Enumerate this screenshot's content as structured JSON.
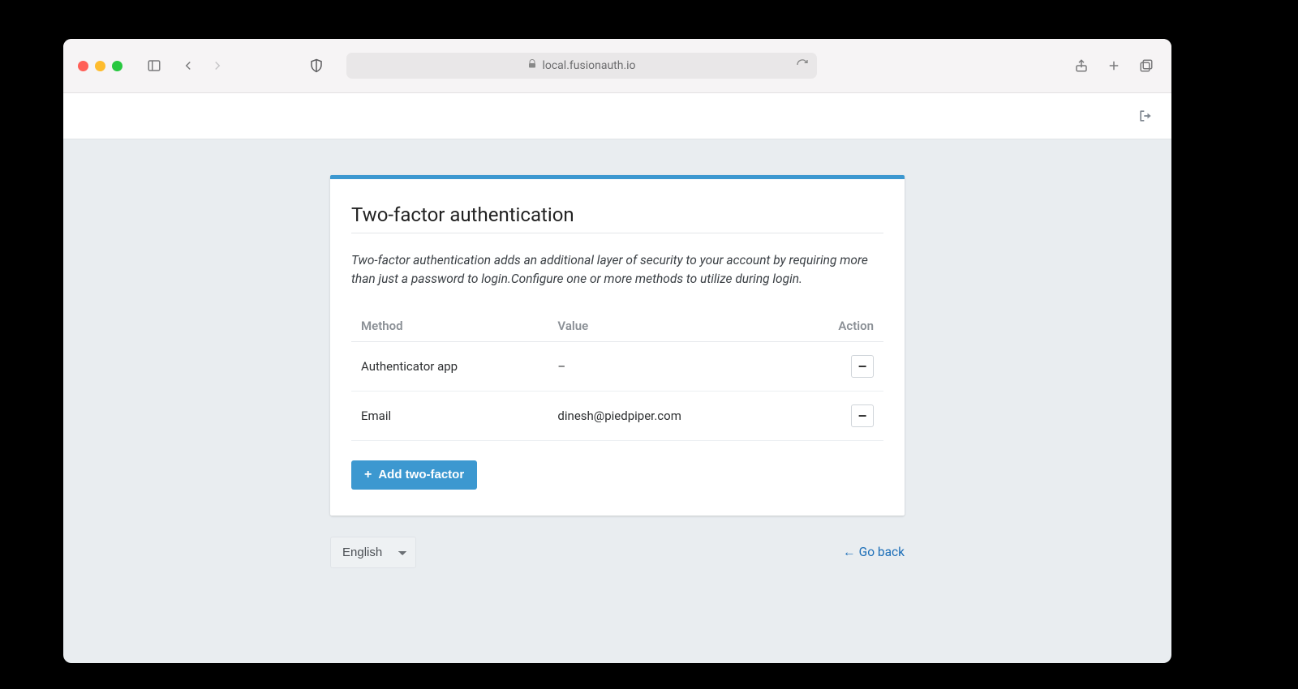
{
  "browser": {
    "url_display": "local.fusionauth.io"
  },
  "page": {
    "title": "Two-factor authentication",
    "description": "Two-factor authentication adds an additional layer of security to your account by requiring more than just a password to login.Configure one or more methods to utilize during login.",
    "table": {
      "headers": {
        "method": "Method",
        "value": "Value",
        "action": "Action"
      },
      "rows": [
        {
          "method": "Authenticator app",
          "value": "–"
        },
        {
          "method": "Email",
          "value": "dinesh@piedpiper.com"
        }
      ]
    },
    "add_button_label": "Add two-factor",
    "language_selected": "English",
    "go_back_label": "Go back"
  }
}
